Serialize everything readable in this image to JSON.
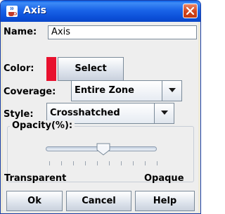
{
  "window": {
    "title": "Axis"
  },
  "form": {
    "name_label": "Name:",
    "name_value": "Axis",
    "color_label": "Color:",
    "color_value": "#e8112e",
    "select_button": "Select",
    "coverage_label": "Coverage:",
    "coverage_value": "Entire Zone",
    "style_label": "Style:",
    "style_value": "Crosshatched"
  },
  "opacity": {
    "group_title": "Opacity(%):",
    "min_label": "Transparent",
    "max_label": "Opaque",
    "level_percent": 50
  },
  "buttons": {
    "ok": "Ok",
    "cancel": "Cancel",
    "help": "Help"
  },
  "icons": {
    "app": "java-cup-icon",
    "close": "close-icon"
  }
}
